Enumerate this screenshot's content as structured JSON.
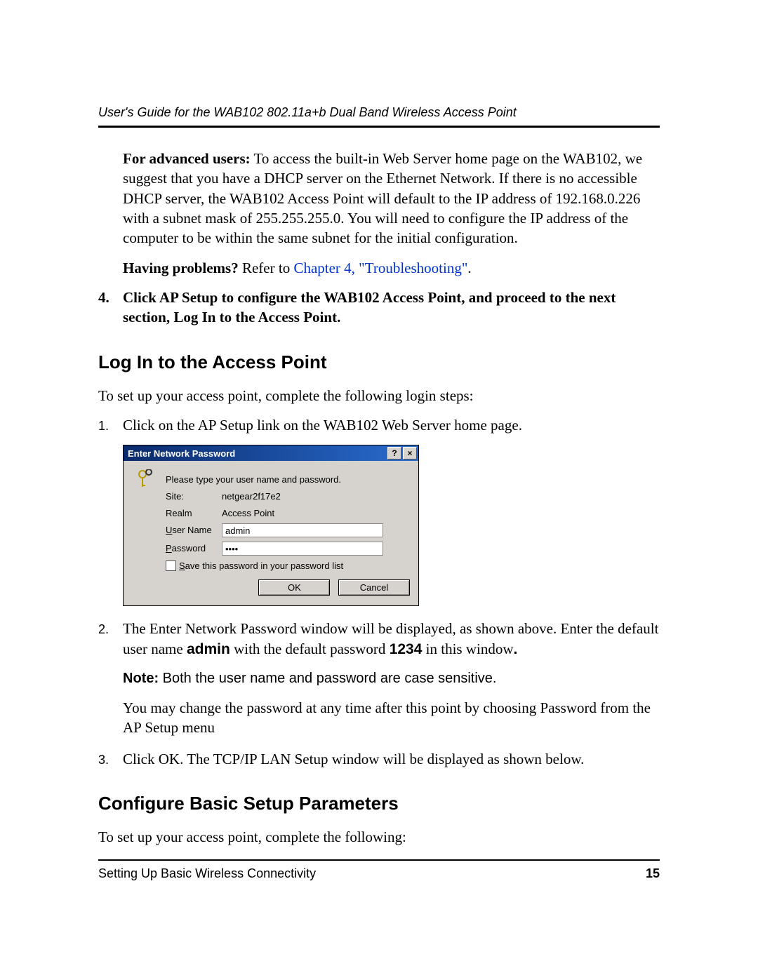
{
  "header": {
    "title": "User's Guide for the WAB102 802.11a+b Dual Band Wireless Access Point"
  },
  "advanced": {
    "label": "For advanced users:",
    "text": " To access the built-in Web Server home page on the WAB102, we suggest that you have a DHCP server on the Ethernet Network. If there is no accessible DHCP server, the WAB102 Access Point will default to the IP address of 192.168.0.226 with a subnet mask of 255.255.255.0. You will need to configure the IP address of the computer to be within the same subnet for the initial configuration."
  },
  "problems": {
    "label": "Having problems?",
    "text": " Refer to ",
    "link": "Chapter 4, \"Troubleshooting\"",
    "trail": "."
  },
  "step4": "Click AP Setup to configure the WAB102 Access Point, and proceed to the next section, Log In to the Access Point.",
  "section1_title": "Log In to the Access Point",
  "section1_intro": "To set up your access point, complete the following login steps:",
  "login_steps": {
    "s1": "Click on the AP Setup link on the WAB102 Web Server home page.",
    "s2_pre": "The Enter Network Password window will be displayed, as shown above. Enter the default user name ",
    "s2_user": "admin",
    "s2_mid": " with the default password ",
    "s2_pass": "1234",
    "s2_post": " in this window",
    "s2_trail": ".",
    "note_label": "Note:",
    "note_text": " Both the user name and password are case sensitive.",
    "s2b": "You may change the password at any time after this point by choosing Password from the AP Setup menu",
    "s3": "Click OK. The TCP/IP LAN Setup window will be displayed as shown below."
  },
  "dialog": {
    "title": "Enter Network Password",
    "prompt": "Please type your user name and password.",
    "site_label": "Site:",
    "site_value": "netgear2f17e2",
    "realm_label": "Realm",
    "realm_value": "Access Point",
    "user_label": "User Name",
    "user_value": "admin",
    "pass_label": "Password",
    "pass_value": "••••",
    "save_label": "Save this password in your password list",
    "ok": "OK",
    "cancel": "Cancel"
  },
  "section2_title": "Configure Basic Setup Parameters",
  "section2_intro": "To set up your access point, complete the following:",
  "footer": {
    "left": "Setting Up Basic Wireless Connectivity",
    "page": "15"
  }
}
